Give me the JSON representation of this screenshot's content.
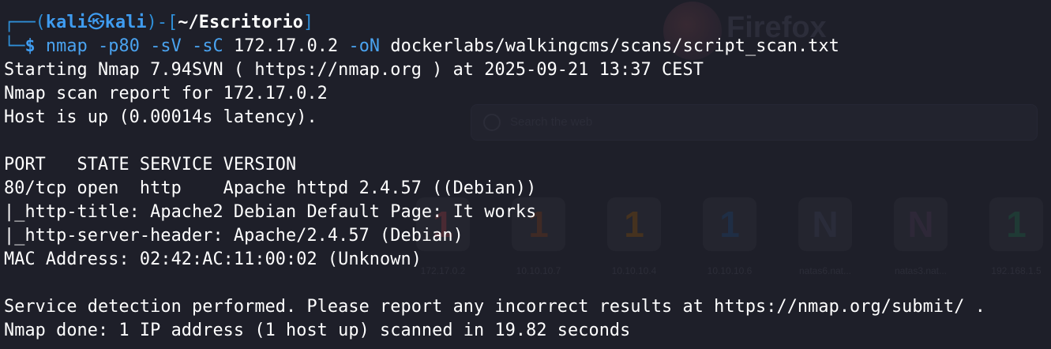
{
  "background": {
    "browser_name": "Firefox",
    "search_placeholder": "Search the web",
    "shortcuts": [
      {
        "label": "172.17.0.2",
        "glyph": "1",
        "color": "#4a2a33"
      },
      {
        "label": "10.10.10.7",
        "glyph": "1",
        "color": "#3f2a25"
      },
      {
        "label": "10.10.10.4",
        "glyph": "1",
        "color": "#45321f"
      },
      {
        "label": "10.10.10.6",
        "glyph": "1",
        "color": "#1f2e45"
      },
      {
        "label": "natas6.nat...",
        "glyph": "N",
        "color": "#2a2c3a"
      },
      {
        "label": "natas3.nat...",
        "glyph": "N",
        "color": "#2e2838"
      },
      {
        "label": "192.168.1.5",
        "glyph": "1",
        "color": "#1f3a35"
      }
    ]
  },
  "prompt": {
    "frame_open": "┌──(",
    "user": "kali",
    "separator": "㉿",
    "host": "kali",
    "frame_mid": ")-[",
    "path": "~/Escritorio",
    "frame_close": "]",
    "frame_bottom": "└─",
    "symbol": "$",
    "command": "nmap",
    "flags": [
      "-p80",
      "-sV",
      "-sC"
    ],
    "target": "172.17.0.2",
    "output_flag": "-oN",
    "output_file": "dockerlabs/walkingcms/scans/script_scan.txt"
  },
  "output_lines": [
    "Starting Nmap 7.94SVN ( https://nmap.org ) at 2025-09-21 13:37 CEST",
    "Nmap scan report for 172.17.0.2",
    "Host is up (0.00014s latency).",
    "",
    "PORT   STATE SERVICE VERSION",
    "80/tcp open  http    Apache httpd 2.4.57 ((Debian))",
    "|_http-title: Apache2 Debian Default Page: It works",
    "|_http-server-header: Apache/2.4.57 (Debian)",
    "MAC Address: 02:42:AC:11:00:02 (Unknown)",
    "",
    "Service detection performed. Please report any incorrect results at https://nmap.org/submit/ .",
    "Nmap done: 1 IP address (1 host up) scanned in 19.82 seconds"
  ]
}
